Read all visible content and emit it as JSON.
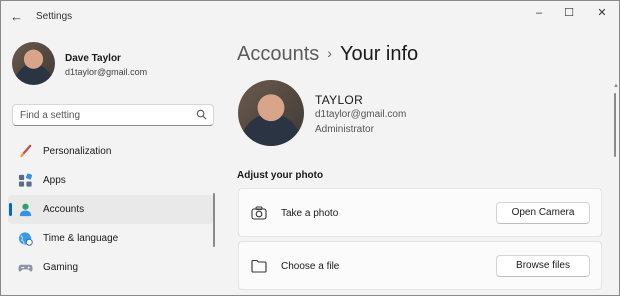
{
  "window": {
    "title": "Settings"
  },
  "profile": {
    "name": "Dave Taylor",
    "email": "d1taylor@gmail.com"
  },
  "search": {
    "placeholder": "Find a setting"
  },
  "nav": {
    "items": [
      {
        "label": "Personalization",
        "icon": "paintbrush-icon"
      },
      {
        "label": "Apps",
        "icon": "apps-icon"
      },
      {
        "label": "Accounts",
        "icon": "person-icon",
        "active": true
      },
      {
        "label": "Time & language",
        "icon": "globe-clock-icon"
      },
      {
        "label": "Gaming",
        "icon": "gamepad-icon"
      }
    ]
  },
  "breadcrumb": {
    "parent": "Accounts",
    "separator": "›",
    "current": "Your info"
  },
  "info": {
    "name": "TAYLOR",
    "email": "d1taylor@gmail.com",
    "role": "Administrator"
  },
  "photo_section": {
    "title": "Adjust your photo",
    "rows": [
      {
        "label": "Take a photo",
        "button": "Open Camera",
        "icon": "camera-icon"
      },
      {
        "label": "Choose a file",
        "button": "Browse files",
        "icon": "folder-icon"
      }
    ]
  },
  "colors": {
    "accent": "#0067c0",
    "background": "#f3f3f3"
  }
}
